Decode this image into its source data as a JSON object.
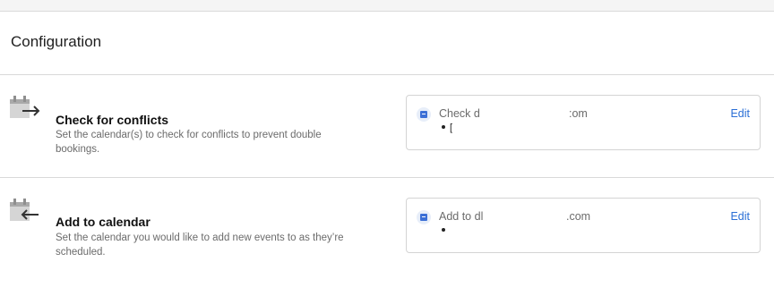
{
  "header": {
    "title": "Configuration"
  },
  "sections": [
    {
      "title": "Check for conflicts",
      "description": "Set the calendar(s) to check for conflicts to prevent double bookings.",
      "card": {
        "label": "Check d",
        "label_tail": ":om",
        "list_item": "[",
        "edit_label": "Edit"
      }
    },
    {
      "title": "Add to calendar",
      "description": "Set the calendar you would like to add new events to as they’re scheduled.",
      "card": {
        "label": "Add to dl",
        "label_tail": ".com",
        "list_item": "",
        "edit_label": "Edit"
      }
    }
  ],
  "icons": {
    "conflicts": "calendar-arrow-right-icon",
    "add": "calendar-arrow-left-icon",
    "card": "google-calendar-icon"
  },
  "colors": {
    "link": "#2b6fd6",
    "divider": "#d9d9d9",
    "muted_text": "#6b6b6b"
  }
}
